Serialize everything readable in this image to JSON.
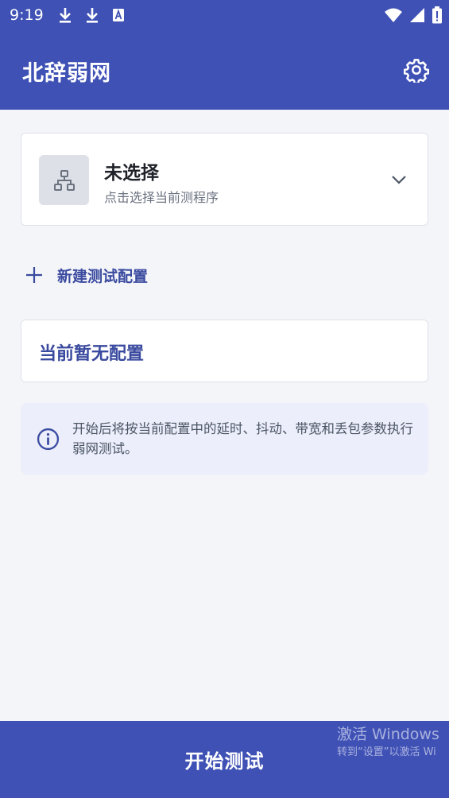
{
  "status_bar": {
    "time": "9:19",
    "icons": [
      "download-icon",
      "download-icon",
      "text-a-icon",
      "wifi-icon",
      "signal-icon",
      "battery-icon"
    ]
  },
  "app_bar": {
    "title": "北辞弱网",
    "settings_icon": "gear-icon"
  },
  "program_selector": {
    "title": "未选择",
    "subtitle": "点击选择当前测程序",
    "icon": "network-tree-icon",
    "chevron_icon": "chevron-down-icon"
  },
  "new_config": {
    "label": "新建测试配置",
    "icon": "plus-icon"
  },
  "current_config": {
    "label": "当前暂无配置"
  },
  "info": {
    "icon": "info-icon",
    "text": "开始后将按当前配置中的延时、抖动、带宽和丢包参数执行弱网测试。"
  },
  "bottom": {
    "start_label": "开始测试"
  },
  "watermark": {
    "line1": "激活 Windows",
    "line2": "转到“设置”以激活 Wi"
  },
  "colors": {
    "primary": "#3f51b5",
    "accent_text": "#3a4a9f",
    "background": "#f4f5f9",
    "info_bg": "#eceefb"
  }
}
